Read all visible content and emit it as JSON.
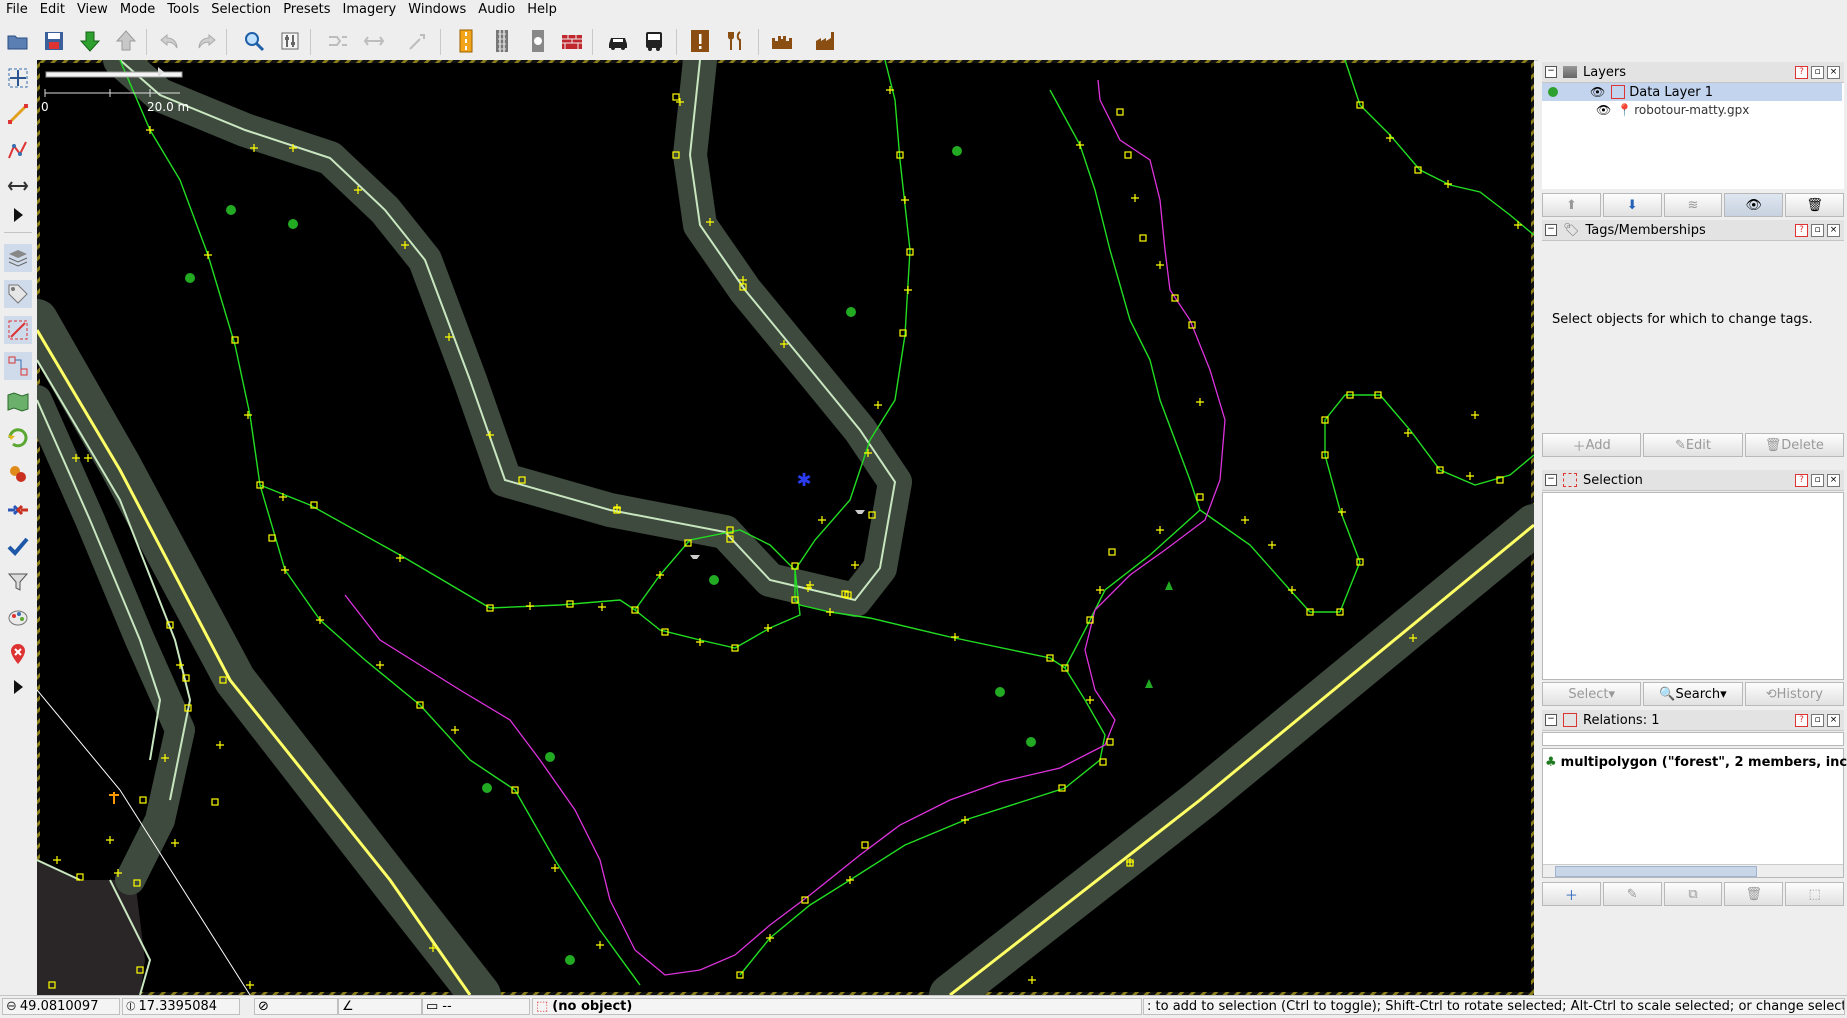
{
  "menu": [
    "File",
    "Edit",
    "View",
    "Mode",
    "Tools",
    "Selection",
    "Presets",
    "Imagery",
    "Windows",
    "Audio",
    "Help"
  ],
  "toolbar_icons": [
    "open-file-icon",
    "save-icon",
    "download-icon",
    "upload-icon",
    "undo-icon",
    "redo-icon",
    "zoom-icon",
    "preferences-icon",
    "merge-icon",
    "split-icon",
    "combine-icon",
    "road-preset-icon",
    "rail-preset-icon",
    "level-crossing-icon",
    "wall-preset-icon",
    "car-icon",
    "bus-icon",
    "warning-icon",
    "restaurant-icon",
    "castle-icon",
    "factory-icon"
  ],
  "left_tools": [
    "select-tool-icon",
    "draw-tool-icon",
    "improve-way-icon",
    "extrude-icon",
    "more-tools-icon",
    "layers-toggle-icon",
    "tags-toggle-icon",
    "selection-toggle-icon",
    "relations-toggle-icon",
    "minimap-icon",
    "history-icon",
    "changesets-icon",
    "conflict-icon",
    "validation-icon",
    "filter-icon",
    "map-paint-icon",
    "notes-icon",
    "more-toggles-icon"
  ],
  "scale": {
    "min": "0",
    "max": "20.0 m"
  },
  "layers": {
    "title": "Layers",
    "items": [
      {
        "name": "Data Layer 1",
        "selected": true
      },
      {
        "name": "robotour-matty.gpx",
        "selected": false
      }
    ]
  },
  "tags": {
    "title": "Tags/Memberships",
    "empty_message": "Select objects for which to change tags.",
    "buttons": {
      "add": "Add",
      "edit": "Edit",
      "delete": "Delete"
    }
  },
  "selection": {
    "title": "Selection",
    "buttons": {
      "select": "Select",
      "search": "Search",
      "history": "History"
    }
  },
  "relations": {
    "title": "Relations: 1",
    "items": [
      {
        "label": "multipolygon (\"forest\", 2 members, inco"
      }
    ]
  },
  "status": {
    "lat": "49.0810097",
    "lon": "17.3395084",
    "distance": "--",
    "object": "(no object)",
    "help": ": to add to selection (Ctrl to toggle); Shift-Ctrl to rotate selected; Alt-Ctrl to scale selected; or change selection"
  },
  "colors": {
    "road_casing": "#3e4a3e",
    "highway": "#ffff66",
    "footway": "#22dd22",
    "gpx_track": "#dd33dd",
    "node": "#ffff00"
  }
}
